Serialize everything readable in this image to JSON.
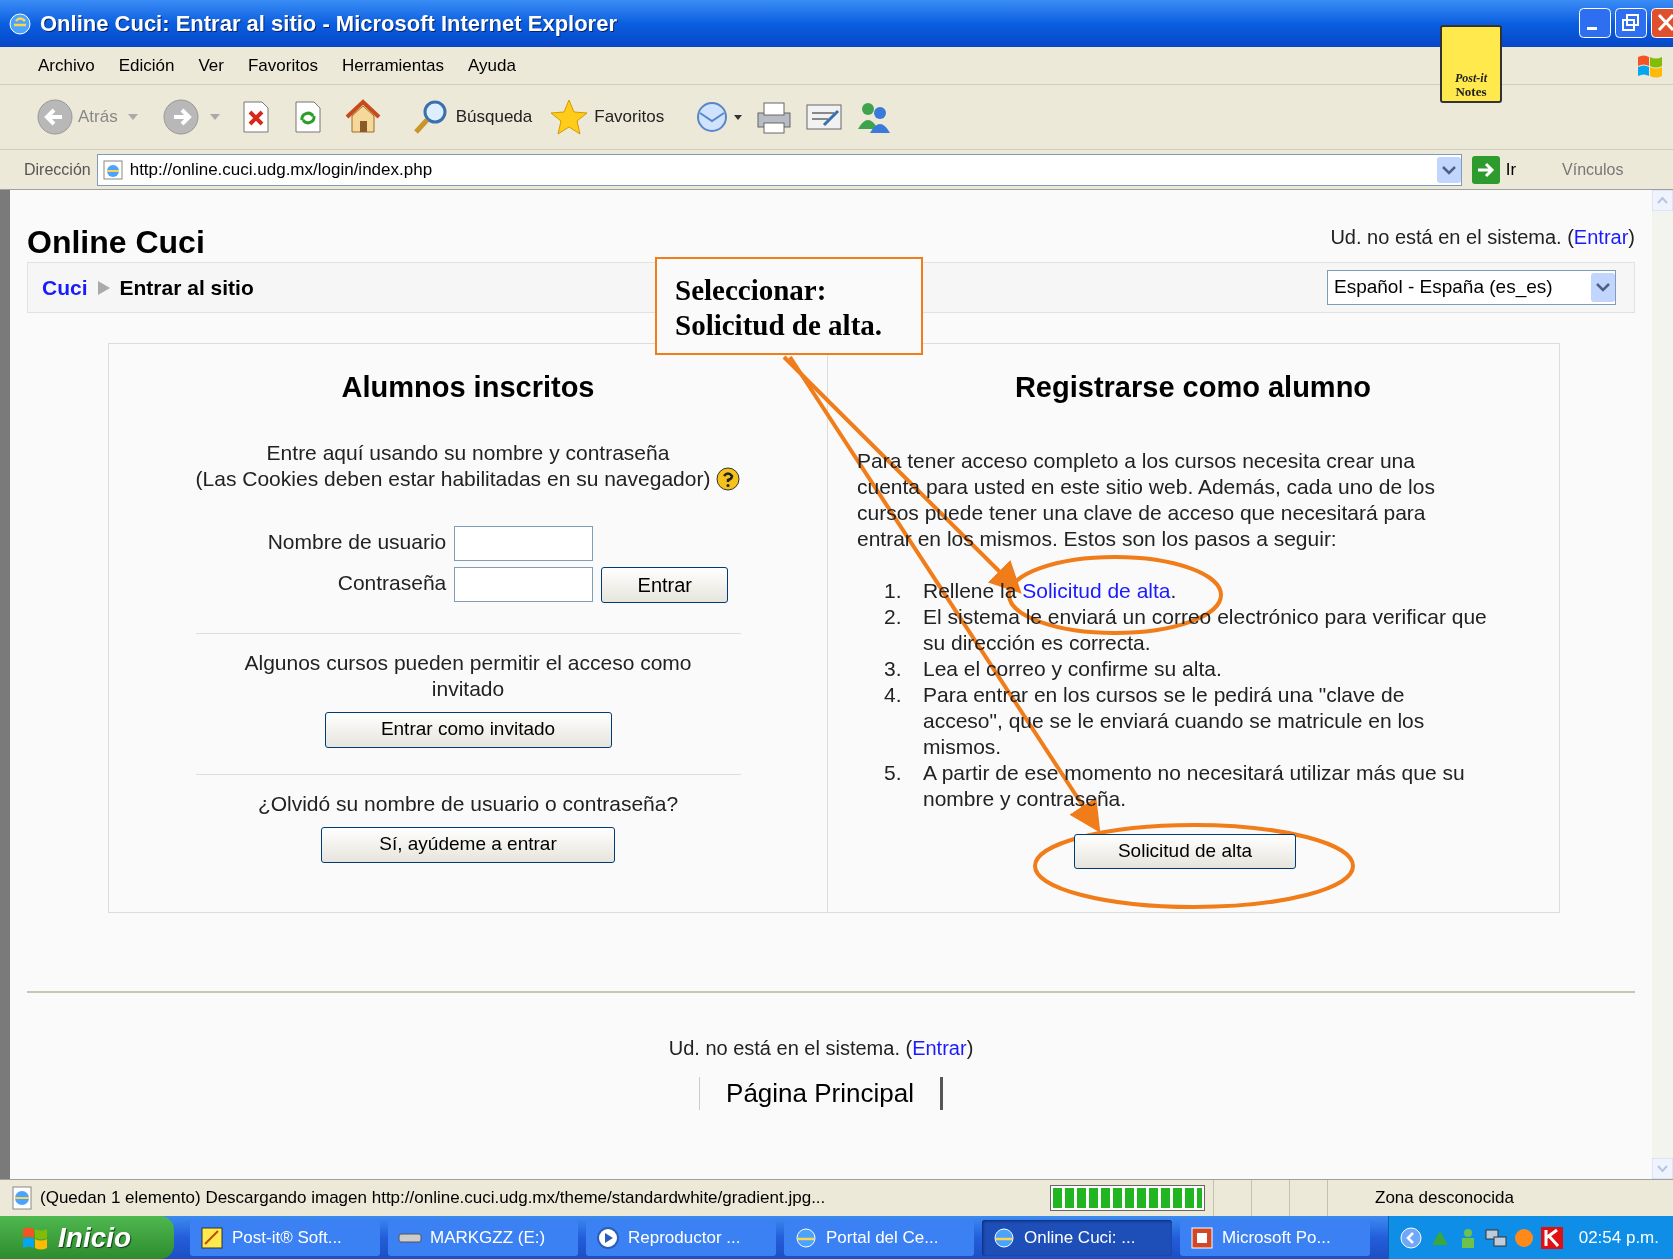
{
  "window": {
    "title": "Online Cuci: Entrar al sitio - Microsoft Internet Explorer"
  },
  "menu": [
    "Archivo",
    "Edición",
    "Ver",
    "Favoritos",
    "Herramientas",
    "Ayuda"
  ],
  "postit_logo": {
    "line1": "Post-it",
    "line2": "Notes"
  },
  "toolbar": {
    "back": "Atrás",
    "search": "Búsqueda",
    "favorites": "Favoritos"
  },
  "address_bar": {
    "label": "Dirección",
    "url": "http://online.cuci.udg.mx/login/index.php",
    "go": "Ir",
    "links": "Vínculos"
  },
  "page": {
    "site_title": "Online Cuci",
    "login_info": {
      "prefix": "Ud. no está en el sistema. (",
      "link": "Entrar",
      "suffix": ")"
    },
    "breadcrumb": [
      "Cuci",
      "Entrar al sitio"
    ],
    "language": "Español - España (es_es)",
    "left_panel": {
      "heading": "Alumnos inscritos",
      "intro": [
        "Entre aquí usando su nombre y contraseña",
        "(Las Cookies deben estar habilitadas en su navegador)"
      ],
      "username_label": "Nombre de usuario",
      "password_label": "Contraseña",
      "login_button": "Entrar",
      "guest_text": "Algunos cursos pueden permitir el acceso como invitado",
      "guest_button": "Entrar como invitado",
      "forgot_text": "¿Olvidó su nombre de usuario o contraseña?",
      "forgot_button": "Sí, ayúdeme a entrar"
    },
    "right_panel": {
      "heading": "Registrarse como alumno",
      "paragraph": "Para tener acceso completo a los cursos necesita crear una cuenta para usted en este sitio web. Además, cada uno de los cursos puede tener una clave de acceso que necesitará para entrar en los mismos. Estos son los pasos a seguir:",
      "steps": [
        {
          "number": "1.",
          "prefix": "Rellene la ",
          "link": "Solicitud de alta",
          "suffix": "."
        },
        {
          "number": "2.",
          "text": "El sistema le enviará un correo electrónico para verificar que su dirección es correcta."
        },
        {
          "number": "3.",
          "text": "Lea el correo y confirme su alta."
        },
        {
          "number": "4.",
          "text": "Para entrar en los cursos se le pedirá una \"clave de acceso\", que se le enviará cuando se matricule en los mismos."
        },
        {
          "number": "5.",
          "text": "A partir de ese momento no necesitará utilizar más que su nombre y contraseña."
        }
      ],
      "signup_button": "Solicitud de alta"
    },
    "footer": {
      "login_info": {
        "prefix": "Ud. no está en el sistema. (",
        "link": "Entrar",
        "suffix": ")"
      },
      "home_link": "Página Principal"
    }
  },
  "annotation": {
    "lines": [
      "Seleccionar:",
      "Solicitud de alta."
    ]
  },
  "status_bar": {
    "text": "(Quedan 1 elemento) Descargando imagen http://online.cuci.udg.mx/theme/standardwhite/gradient.jpg...",
    "level": 1,
    "zone": "Zona desconocida"
  },
  "taskbar": {
    "start": "Inicio",
    "tasks": [
      {
        "label": "Post-it® Soft...",
        "kind": "postit",
        "selected": false
      },
      {
        "label": "MARKGZZ (E:)",
        "kind": "drive",
        "selected": false
      },
      {
        "label": "Reproductor ...",
        "kind": "media",
        "selected": false
      },
      {
        "label": "Portal del Ce...",
        "kind": "ie",
        "selected": false
      },
      {
        "label": "Online Cuci: ...",
        "kind": "ie",
        "selected": true
      },
      {
        "label": "Microsoft Po...",
        "kind": "ppt",
        "selected": false
      }
    ],
    "clock": "02:54 p.m."
  }
}
